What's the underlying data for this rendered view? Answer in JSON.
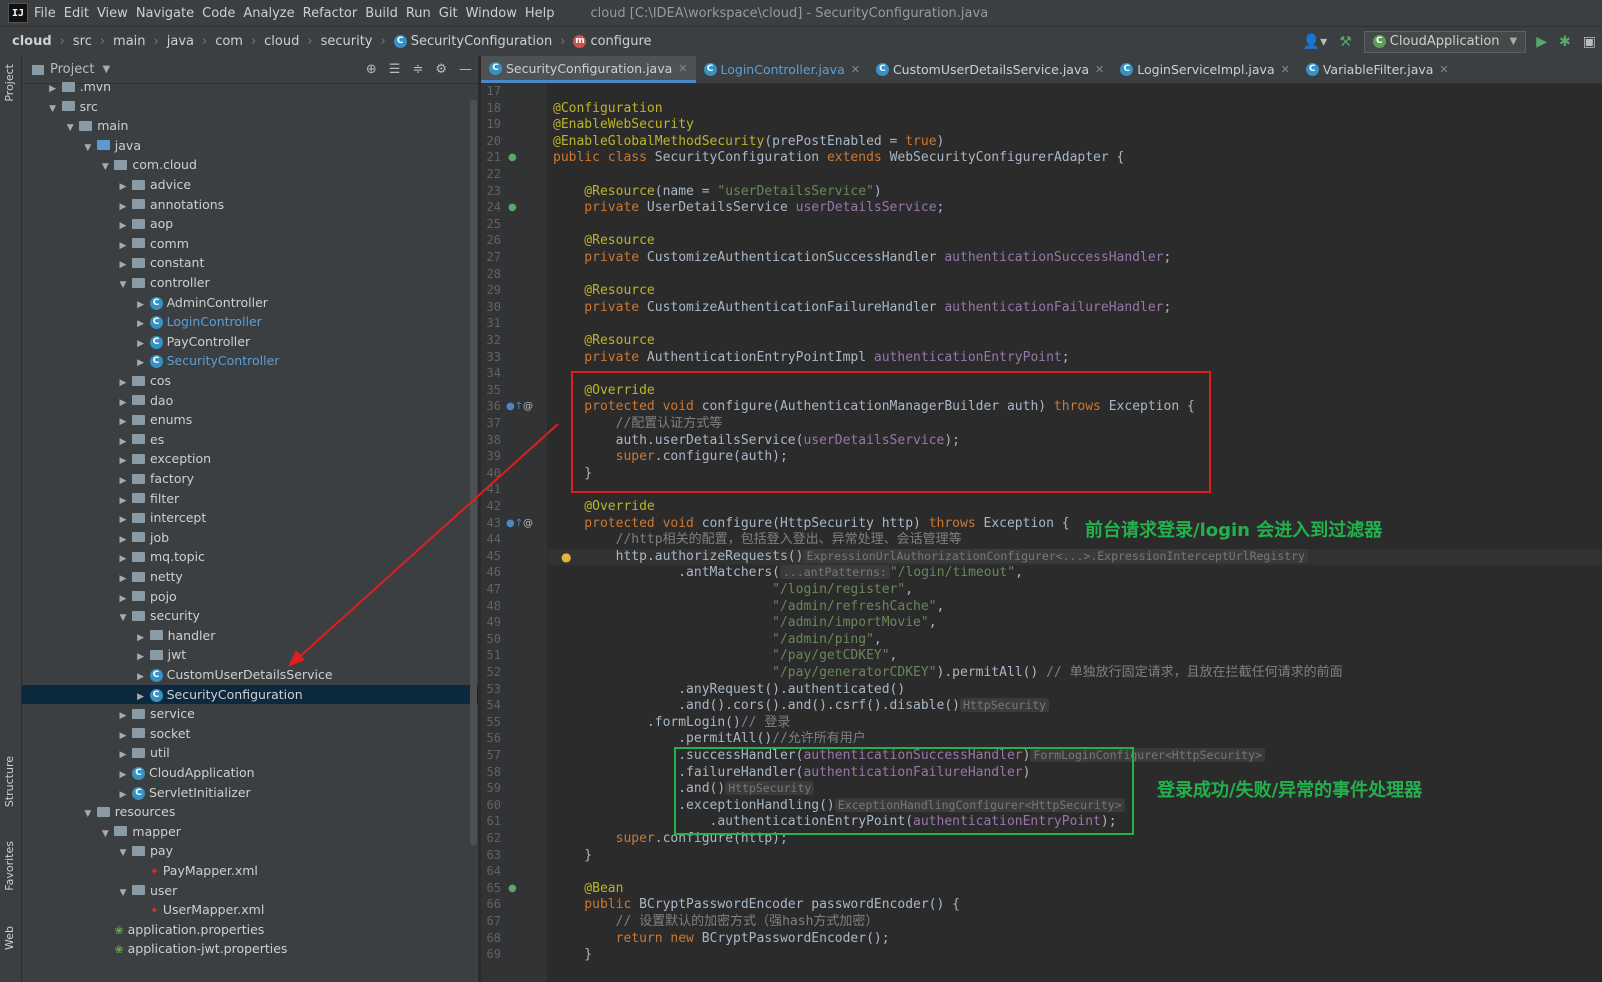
{
  "menubar": {
    "items": [
      "File",
      "Edit",
      "View",
      "Navigate",
      "Code",
      "Analyze",
      "Refactor",
      "Build",
      "Run",
      "Git",
      "Window",
      "Help"
    ],
    "title": "cloud [C:\\IDEA\\workspace\\cloud] - SecurityConfiguration.java"
  },
  "breadcrumbs": [
    "cloud",
    "src",
    "main",
    "java",
    "com",
    "cloud",
    "security",
    "SecurityConfiguration",
    "configure"
  ],
  "run_config": "CloudApplication",
  "left_strip": {
    "project": "Project",
    "structure": "Structure",
    "favorites": "Favorites",
    "web": "Web"
  },
  "project_panel": {
    "title": "Project",
    "tree": [
      {
        "label": ".mvn",
        "depth": 1,
        "kind": "folder",
        "arrow": "right"
      },
      {
        "label": "src",
        "depth": 1,
        "kind": "folder",
        "arrow": "down"
      },
      {
        "label": "main",
        "depth": 2,
        "kind": "folder",
        "arrow": "down"
      },
      {
        "label": "java",
        "depth": 3,
        "kind": "folder-blue",
        "arrow": "down"
      },
      {
        "label": "com.cloud",
        "depth": 4,
        "kind": "folder",
        "arrow": "down"
      },
      {
        "label": "advice",
        "depth": 5,
        "kind": "folder",
        "arrow": "right"
      },
      {
        "label": "annotations",
        "depth": 5,
        "kind": "folder",
        "arrow": "right"
      },
      {
        "label": "aop",
        "depth": 5,
        "kind": "folder",
        "arrow": "right"
      },
      {
        "label": "comm",
        "depth": 5,
        "kind": "folder",
        "arrow": "right"
      },
      {
        "label": "constant",
        "depth": 5,
        "kind": "folder",
        "arrow": "right"
      },
      {
        "label": "controller",
        "depth": 5,
        "kind": "folder",
        "arrow": "down"
      },
      {
        "label": "AdminController",
        "depth": 6,
        "kind": "class",
        "arrow": "right"
      },
      {
        "label": "LoginController",
        "depth": 6,
        "kind": "class",
        "arrow": "right",
        "blue": true
      },
      {
        "label": "PayController",
        "depth": 6,
        "kind": "class",
        "arrow": "right"
      },
      {
        "label": "SecurityController",
        "depth": 6,
        "kind": "class",
        "arrow": "right",
        "blue": true
      },
      {
        "label": "cos",
        "depth": 5,
        "kind": "folder",
        "arrow": "right"
      },
      {
        "label": "dao",
        "depth": 5,
        "kind": "folder",
        "arrow": "right"
      },
      {
        "label": "enums",
        "depth": 5,
        "kind": "folder",
        "arrow": "right"
      },
      {
        "label": "es",
        "depth": 5,
        "kind": "folder",
        "arrow": "right"
      },
      {
        "label": "exception",
        "depth": 5,
        "kind": "folder",
        "arrow": "right"
      },
      {
        "label": "factory",
        "depth": 5,
        "kind": "folder",
        "arrow": "right"
      },
      {
        "label": "filter",
        "depth": 5,
        "kind": "folder",
        "arrow": "right"
      },
      {
        "label": "intercept",
        "depth": 5,
        "kind": "folder",
        "arrow": "right"
      },
      {
        "label": "job",
        "depth": 5,
        "kind": "folder",
        "arrow": "right"
      },
      {
        "label": "mq.topic",
        "depth": 5,
        "kind": "folder",
        "arrow": "right"
      },
      {
        "label": "netty",
        "depth": 5,
        "kind": "folder",
        "arrow": "right"
      },
      {
        "label": "pojo",
        "depth": 5,
        "kind": "folder",
        "arrow": "right"
      },
      {
        "label": "security",
        "depth": 5,
        "kind": "folder",
        "arrow": "down"
      },
      {
        "label": "handler",
        "depth": 6,
        "kind": "folder",
        "arrow": "right"
      },
      {
        "label": "jwt",
        "depth": 6,
        "kind": "folder",
        "arrow": "right"
      },
      {
        "label": "CustomUserDetailsService",
        "depth": 6,
        "kind": "class",
        "arrow": "right"
      },
      {
        "label": "SecurityConfiguration",
        "depth": 6,
        "kind": "class",
        "arrow": "right",
        "selected": true
      },
      {
        "label": "service",
        "depth": 5,
        "kind": "folder",
        "arrow": "right"
      },
      {
        "label": "socket",
        "depth": 5,
        "kind": "folder",
        "arrow": "right"
      },
      {
        "label": "util",
        "depth": 5,
        "kind": "folder",
        "arrow": "right"
      },
      {
        "label": "CloudApplication",
        "depth": 5,
        "kind": "class",
        "arrow": "right"
      },
      {
        "label": "ServletInitializer",
        "depth": 5,
        "kind": "class",
        "arrow": "right"
      },
      {
        "label": "resources",
        "depth": 3,
        "kind": "folder",
        "arrow": "down"
      },
      {
        "label": "mapper",
        "depth": 4,
        "kind": "folder",
        "arrow": "down"
      },
      {
        "label": "pay",
        "depth": 5,
        "kind": "folder",
        "arrow": "down"
      },
      {
        "label": "PayMapper.xml",
        "depth": 6,
        "kind": "xml",
        "arrow": ""
      },
      {
        "label": "user",
        "depth": 5,
        "kind": "folder",
        "arrow": "down"
      },
      {
        "label": "UserMapper.xml",
        "depth": 6,
        "kind": "xml",
        "arrow": ""
      },
      {
        "label": "application.properties",
        "depth": 4,
        "kind": "props",
        "arrow": ""
      },
      {
        "label": "application-jwt.properties",
        "depth": 4,
        "kind": "props",
        "arrow": ""
      }
    ]
  },
  "tabs": [
    {
      "label": "SecurityConfiguration.java",
      "active": true,
      "blue": false
    },
    {
      "label": "LoginController.java",
      "active": false,
      "blue": true
    },
    {
      "label": "CustomUserDetailsService.java",
      "active": false,
      "blue": false
    },
    {
      "label": "LoginServiceImpl.java",
      "active": false,
      "blue": false
    },
    {
      "label": "VariableFilter.java",
      "active": false,
      "blue": false
    }
  ],
  "code": {
    "first_line": 17,
    "lines": [
      [],
      [
        [
          "an",
          "@Configuration"
        ]
      ],
      [
        [
          "an",
          "@EnableWebSecurity"
        ]
      ],
      [
        [
          "an",
          "@EnableGlobalMethodSecurity"
        ],
        [
          "pm",
          "(prePostEnabled = "
        ],
        [
          "kw",
          "true"
        ],
        [
          "pm",
          ")"
        ]
      ],
      [
        [
          "kw",
          "public class "
        ],
        [
          "cls",
          "SecurityConfiguration "
        ],
        [
          "kw",
          "extends "
        ],
        [
          "cls",
          "WebSecurityConfigurerAdapter {"
        ]
      ],
      [],
      [
        [
          "an",
          "    @Resource"
        ],
        [
          "pm",
          "(name = "
        ],
        [
          "st",
          "\"userDetailsService\""
        ],
        [
          "pm",
          ")"
        ]
      ],
      [
        [
          "kw",
          "    private "
        ],
        [
          "cls",
          "UserDetailsService "
        ],
        [
          "vr",
          "userDetailsService"
        ],
        [
          "pm",
          ";"
        ]
      ],
      [],
      [
        [
          "an",
          "    @Resource"
        ]
      ],
      [
        [
          "kw",
          "    private "
        ],
        [
          "cls",
          "CustomizeAuthenticationSuccessHandler "
        ],
        [
          "vr",
          "authenticationSuccessHandler"
        ],
        [
          "pm",
          ";"
        ]
      ],
      [],
      [
        [
          "an",
          "    @Resource"
        ]
      ],
      [
        [
          "kw",
          "    private "
        ],
        [
          "cls",
          "CustomizeAuthenticationFailureHandler "
        ],
        [
          "vr",
          "authenticationFailureHandler"
        ],
        [
          "pm",
          ";"
        ]
      ],
      [],
      [
        [
          "an",
          "    @Resource"
        ]
      ],
      [
        [
          "kw",
          "    private "
        ],
        [
          "cls",
          "AuthenticationEntryPointImpl "
        ],
        [
          "vr",
          "authenticationEntryPoint"
        ],
        [
          "pm",
          ";"
        ]
      ],
      [],
      [
        [
          "an",
          "    @Override"
        ]
      ],
      [
        [
          "kw",
          "    protected void "
        ],
        [
          "pm",
          "configure(AuthenticationManagerBuilder auth) "
        ],
        [
          "kw",
          "throws "
        ],
        [
          "pm",
          "Exception {"
        ]
      ],
      [
        [
          "cm",
          "        //配置认证方式等"
        ]
      ],
      [
        [
          "pm",
          "        auth.userDetailsService("
        ],
        [
          "vr",
          "userDetailsService"
        ],
        [
          "pm",
          ");"
        ]
      ],
      [
        [
          "kw",
          "        super"
        ],
        [
          "pm",
          ".configure(auth);"
        ]
      ],
      [
        [
          "pm",
          "    }"
        ]
      ],
      [],
      [
        [
          "an",
          "    @Override"
        ]
      ],
      [
        [
          "kw",
          "    protected void "
        ],
        [
          "pm",
          "configure(HttpSecurity http) "
        ],
        [
          "kw",
          "throws "
        ],
        [
          "pm",
          "Exception {"
        ]
      ],
      [
        [
          "cm",
          "        //http相关的配置，包括登入登出、异常处理、会话管理等"
        ]
      ],
      [
        [
          "pm",
          "        http.authorizeRequests()"
        ],
        [
          "hint",
          "ExpressionUrlAuthorizationConfigurer<...>.ExpressionInterceptUrlRegistry"
        ]
      ],
      [
        [
          "pm",
          "                .antMatchers("
        ],
        [
          "hint",
          "...antPatterns:"
        ],
        [
          "st",
          "\"/login/timeout\""
        ],
        [
          "pm",
          ","
        ]
      ],
      [
        [
          "st",
          "                            \"/login/register\""
        ],
        [
          "pm",
          ","
        ]
      ],
      [
        [
          "st",
          "                            \"/admin/refreshCache\""
        ],
        [
          "pm",
          ","
        ]
      ],
      [
        [
          "st",
          "                            \"/admin/importMovie\""
        ],
        [
          "pm",
          ","
        ]
      ],
      [
        [
          "st",
          "                            \"/admin/ping\""
        ],
        [
          "pm",
          ","
        ]
      ],
      [
        [
          "st",
          "                            \"/pay/getCDKEY\""
        ],
        [
          "pm",
          ","
        ]
      ],
      [
        [
          "st",
          "                            \"/pay/generatorCDKEY\""
        ],
        [
          "pm",
          ").permitAll() "
        ],
        [
          "cm",
          "// 单独放行固定请求，且放在拦截任何请求的前面"
        ]
      ],
      [
        [
          "pm",
          "                .anyRequest().authenticated()"
        ]
      ],
      [
        [
          "pm",
          "                .and().cors().and().csrf().disable()"
        ],
        [
          "hint",
          "HttpSecurity"
        ]
      ],
      [
        [
          "pm",
          "            .formLogin()"
        ],
        [
          "cm",
          "// 登录"
        ]
      ],
      [
        [
          "pm",
          "                .permitAll()"
        ],
        [
          "cm",
          "//允许所有用户"
        ]
      ],
      [
        [
          "pm",
          "                .successHandler("
        ],
        [
          "vr",
          "authenticationSuccessHandler"
        ],
        [
          "pm",
          ")"
        ],
        [
          "hint",
          "FormLoginConfigurer<HttpSecurity>"
        ]
      ],
      [
        [
          "pm",
          "                .failureHandler("
        ],
        [
          "vr",
          "authenticationFailureHandler"
        ],
        [
          "pm",
          ")"
        ]
      ],
      [
        [
          "pm",
          "                .and()"
        ],
        [
          "hint",
          "HttpSecurity"
        ]
      ],
      [
        [
          "pm",
          "                .exceptionHandling()"
        ],
        [
          "hint",
          "ExceptionHandlingConfigurer<HttpSecurity>"
        ]
      ],
      [
        [
          "pm",
          "                    .authenticationEntryPoint("
        ],
        [
          "vr",
          "authenticationEntryPoint"
        ],
        [
          "pm",
          ");"
        ]
      ],
      [
        [
          "kw",
          "        super"
        ],
        [
          "pm",
          ".configure(http);"
        ]
      ],
      [
        [
          "pm",
          "    }"
        ]
      ],
      [],
      [
        [
          "an",
          "    @Bean"
        ]
      ],
      [
        [
          "kw",
          "    public "
        ],
        [
          "pm",
          "BCryptPasswordEncoder passwordEncoder() {"
        ]
      ],
      [
        [
          "cm",
          "        // 设置默认的加密方式（强hash方式加密）"
        ]
      ],
      [
        [
          "kw",
          "        return new "
        ],
        [
          "pm",
          "BCryptPasswordEncoder();"
        ]
      ],
      [
        [
          "pm",
          "    }"
        ]
      ]
    ]
  },
  "annotations": {
    "callout_filter": "前台请求登录/login 会进入到过滤器",
    "callout_handlers": "登录成功/失败/异常的事件处理器",
    "red_color": "#e01e1e",
    "green_color": "#22b14c"
  }
}
